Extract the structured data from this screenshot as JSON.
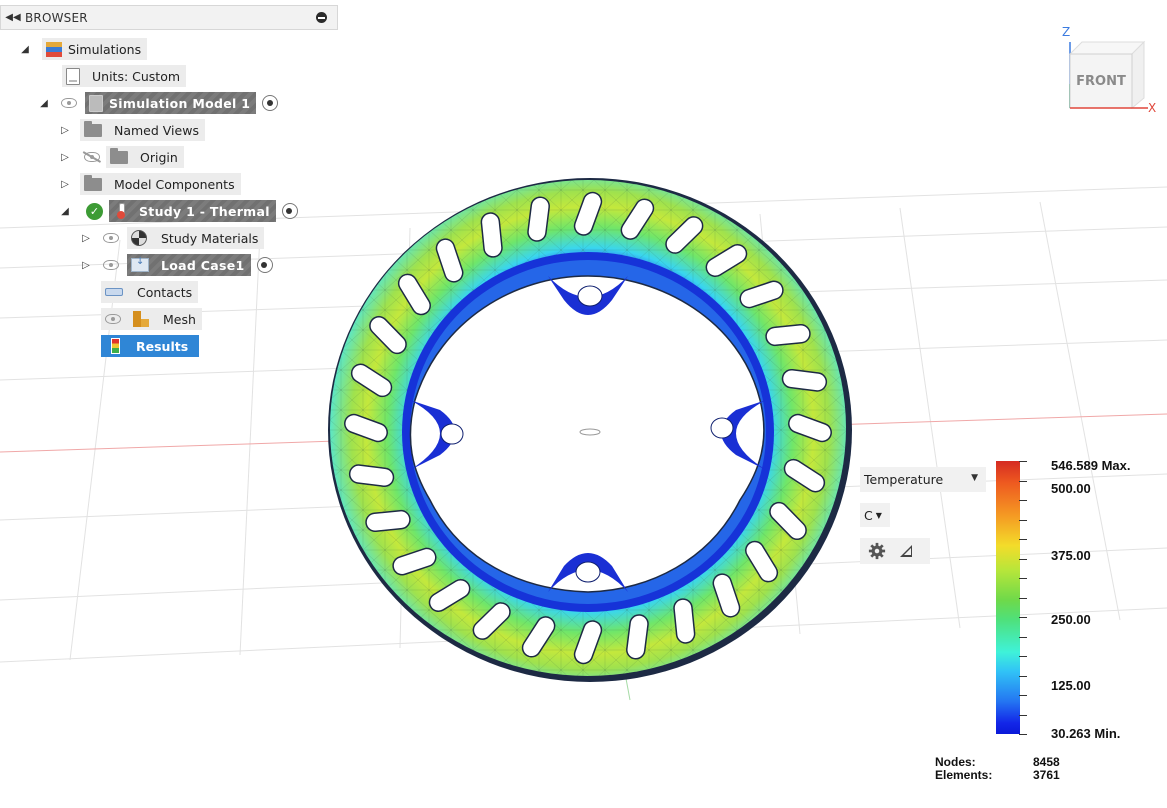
{
  "browser": {
    "title": "BROWSER",
    "collapse_icon": "double-left-arrow-icon",
    "pin_icon": "pin-icon"
  },
  "tree": {
    "simulations": "Simulations",
    "units": "Units: Custom",
    "simulation_model": "Simulation Model 1",
    "named_views": "Named Views",
    "origin": "Origin",
    "model_components": "Model Components",
    "study": "Study 1 - Thermal",
    "study_materials": "Study Materials",
    "load_case": "Load Case1",
    "contacts": "Contacts",
    "mesh": "Mesh",
    "results": "Results"
  },
  "viewcube": {
    "face": "FRONT",
    "axis_z": "Z",
    "axis_x": "X",
    "colors": {
      "z": "#3b7be0",
      "x": "#e0473b",
      "y": "#4db04d"
    }
  },
  "legend": {
    "result_type": "Temperature",
    "unit": "C",
    "max_label": "546.589 Max.",
    "min_label": "30.263 Min.",
    "labels": [
      "500.00",
      "375.00",
      "250.00",
      "125.00"
    ],
    "max_value": 546.589,
    "min_value": 30.263
  },
  "stats": {
    "nodes_label": "Nodes:",
    "nodes_value": "8458",
    "elements_label": "Elements:",
    "elements_value": "3761"
  }
}
